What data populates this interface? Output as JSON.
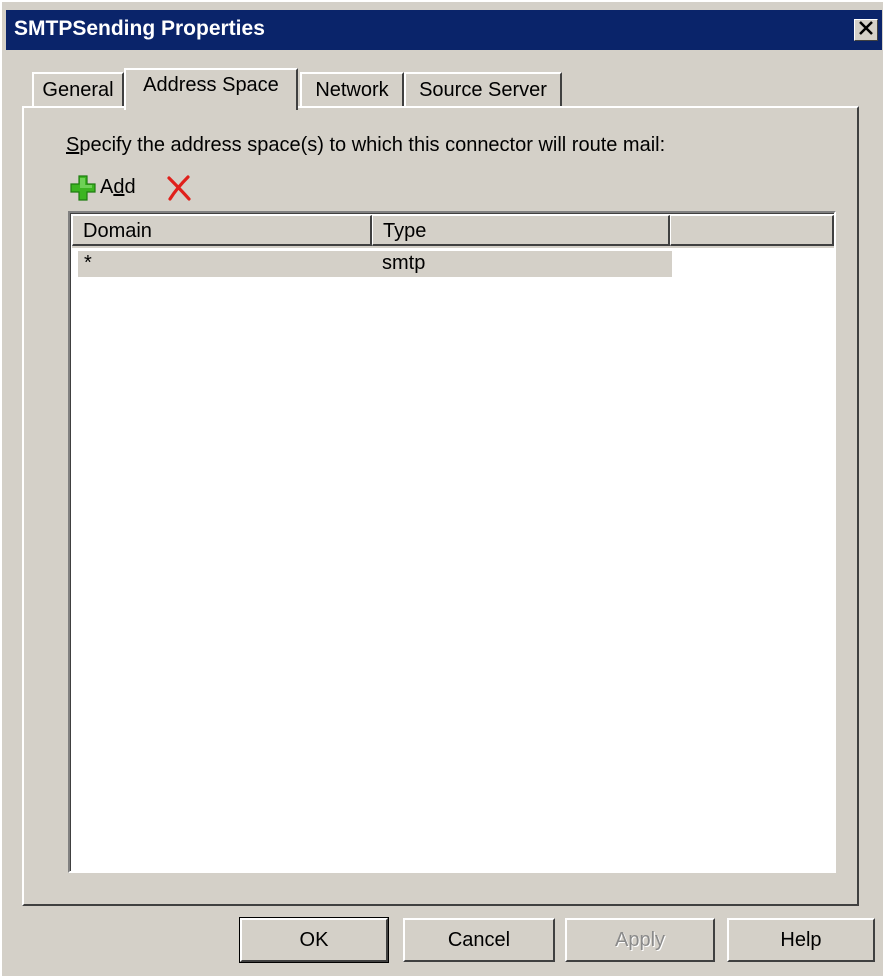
{
  "window": {
    "title": "SMTPSending Properties",
    "close_glyph": "✕"
  },
  "tabs": [
    {
      "label": "General"
    },
    {
      "label": "Address Space",
      "active": true
    },
    {
      "label": "Network"
    },
    {
      "label": "Source Server"
    }
  ],
  "instruction": {
    "prefix": "S",
    "rest": "pecify the address space(s) to which this connector will route mail:"
  },
  "toolbar": {
    "add_label_a": "A",
    "add_label_d": "d",
    "add_label_rest": "d",
    "add_icon": "plus-icon",
    "delete_icon": "delete-x-icon"
  },
  "list": {
    "columns": [
      "Domain",
      "Type"
    ],
    "rows": [
      {
        "domain": "*",
        "type": "smtp"
      }
    ]
  },
  "buttons": {
    "ok": "OK",
    "cancel": "Cancel",
    "apply": "Apply",
    "help": "Help"
  },
  "colors": {
    "titlebar": "#0a246a",
    "face": "#d4d0c8",
    "add_green": "#3cb521",
    "delete_red": "#e0201b"
  }
}
